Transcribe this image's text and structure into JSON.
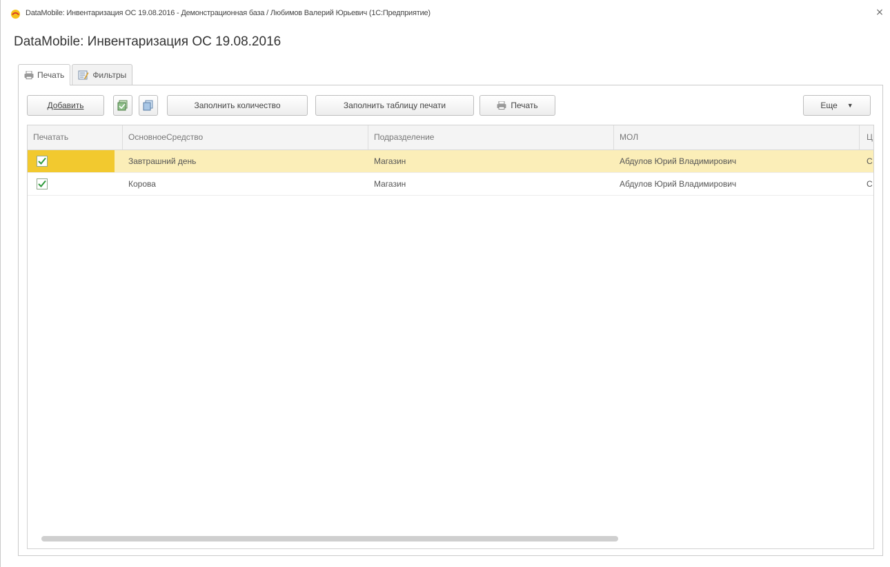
{
  "window": {
    "title": "DataMobile: Инвентаризация ОС 19.08.2016 - Демонстрационная база / Любимов Валерий Юрьевич (1С:Предприятие)",
    "close_glyph": "×",
    "accent_color": "#f2c92f"
  },
  "form": {
    "title": "DataMobile: Инвентаризация ОС 19.08.2016"
  },
  "tabs": [
    {
      "label": "Печать",
      "icon": "printer-icon",
      "active": true
    },
    {
      "label": "Фильтры",
      "icon": "filter-icon",
      "active": false
    }
  ],
  "toolbar": {
    "add_label": "Добавить",
    "icon1": "check-all-icon",
    "icon2": "copy-icon",
    "fill_qty_label": "Заполнить количество",
    "fill_table_label": "Заполнить таблицу печати",
    "print_label": "Печать",
    "more_label": "Еще",
    "more_caret": "▼"
  },
  "table": {
    "columns": [
      "Печатать",
      "ОсновноеСредство",
      "Подразделение",
      "МОЛ",
      "Ц"
    ],
    "rows": [
      {
        "print": true,
        "asset": "Завтрашний день",
        "department": "Магазин",
        "mol": "Абдулов Юрий Владимирович",
        "extra": "С",
        "selected": true
      },
      {
        "print": true,
        "asset": "Корова",
        "department": "Магазин",
        "mol": "Абдулов Юрий Владимирович",
        "extra": "С",
        "selected": false
      }
    ]
  }
}
